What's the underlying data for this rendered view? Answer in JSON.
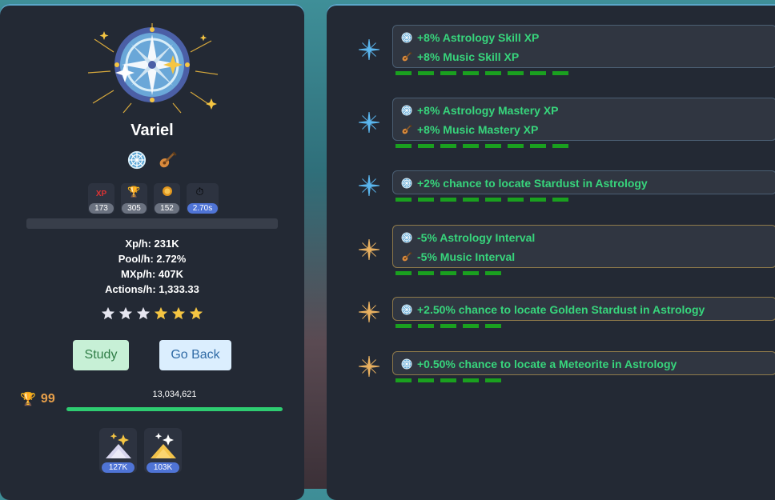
{
  "character": {
    "name": "Variel"
  },
  "badges": [
    {
      "icon": "xp-icon",
      "label": "XP",
      "value": "173"
    },
    {
      "icon": "trophy-icon",
      "value": "305"
    },
    {
      "icon": "medal-icon",
      "value": "152"
    },
    {
      "icon": "stopwatch-icon",
      "value": "2.70s"
    }
  ],
  "stats": {
    "xph": "Xp/h: 231K",
    "poolh": "Pool/h: 2.72%",
    "mxph": "MXp/h: 407K",
    "actionsh": "Actions/h: 1,333.33"
  },
  "stars": {
    "total": 6,
    "gold": 3
  },
  "buttons": {
    "study": "Study",
    "back": "Go Back"
  },
  "level": {
    "value": "99",
    "xp": "13,034,621",
    "progress": 1.0
  },
  "items": [
    {
      "icon": "stardust-icon",
      "value": "127K",
      "color": "#d8d6ee"
    },
    {
      "icon": "golden-stardust-icon",
      "value": "103K",
      "color": "#f3c34a"
    }
  ],
  "colors": {
    "green": "#37d57c",
    "blue_star": "#5ab6ee",
    "gold_star": "#e8b060"
  },
  "modifiers": [
    {
      "star": "blue",
      "lines": [
        {
          "icon": "astrology-icon",
          "text": "+8% Astrology Skill XP"
        },
        {
          "icon": "music-icon",
          "text": "+8% Music Skill XP"
        }
      ],
      "dashes": 8
    },
    {
      "star": "blue",
      "lines": [
        {
          "icon": "astrology-icon",
          "text": "+8% Astrology Mastery XP"
        },
        {
          "icon": "music-icon",
          "text": "+8% Music Mastery XP"
        }
      ],
      "dashes": 8
    },
    {
      "star": "blue",
      "lines": [
        {
          "icon": "astrology-icon",
          "text": "+2% chance to locate Stardust in Astrology"
        }
      ],
      "dashes": 8
    },
    {
      "star": "gold",
      "lines": [
        {
          "icon": "astrology-icon",
          "text": "-5% Astrology Interval"
        },
        {
          "icon": "music-icon",
          "text": "-5% Music Interval"
        }
      ],
      "dashes": 5
    },
    {
      "star": "gold",
      "lines": [
        {
          "icon": "astrology-icon",
          "text": "+2.50% chance to locate Golden Stardust in Astrology"
        }
      ],
      "dashes": 5
    },
    {
      "star": "gold",
      "lines": [
        {
          "icon": "astrology-icon",
          "text": "+0.50% chance to locate a Meteorite in Astrology"
        }
      ],
      "dashes": 5
    }
  ]
}
